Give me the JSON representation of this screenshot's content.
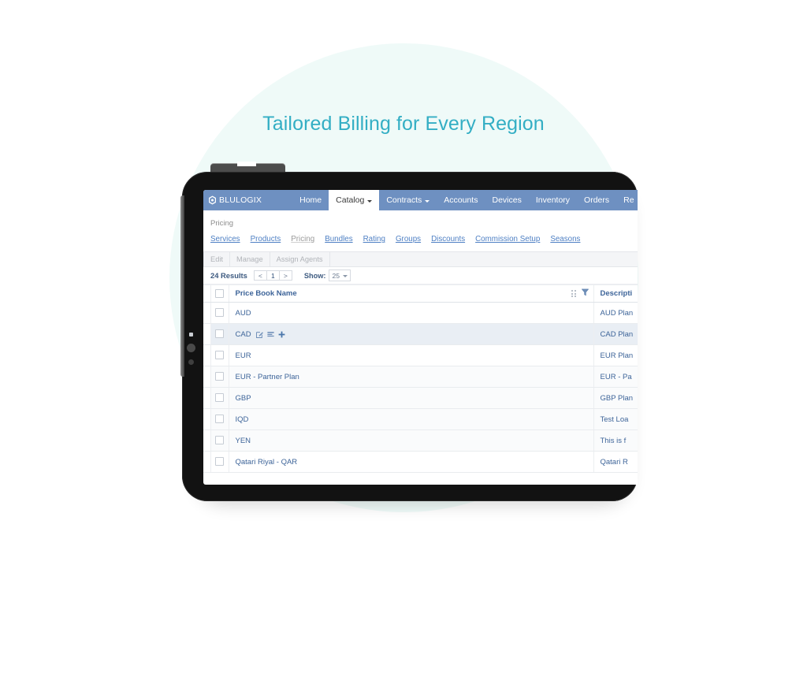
{
  "hero": {
    "title": "Tailored Billing for Every Region",
    "title_color": "#33aec4",
    "blob_color": "#effaf8"
  },
  "app": {
    "brand": "BLULOGIX",
    "brand_icon": "hexagon-logo-icon",
    "nav_bar_color": "#6e90c1",
    "nav": [
      {
        "label": "Home",
        "active": false,
        "has_caret": false
      },
      {
        "label": "Catalog",
        "active": true,
        "has_caret": true
      },
      {
        "label": "Contracts",
        "active": false,
        "has_caret": true
      },
      {
        "label": "Accounts",
        "active": false,
        "has_caret": false
      },
      {
        "label": "Devices",
        "active": false,
        "has_caret": false
      },
      {
        "label": "Inventory",
        "active": false,
        "has_caret": false
      },
      {
        "label": "Orders",
        "active": false,
        "has_caret": false
      },
      {
        "label": "Re",
        "active": false,
        "has_caret": false
      }
    ],
    "breadcrumb": "Pricing",
    "subtabs": [
      {
        "label": "Services",
        "current": false
      },
      {
        "label": "Products",
        "current": false
      },
      {
        "label": "Pricing",
        "current": true
      },
      {
        "label": "Bundles",
        "current": false
      },
      {
        "label": "Rating",
        "current": false
      },
      {
        "label": "Groups",
        "current": false
      },
      {
        "label": "Discounts",
        "current": false
      },
      {
        "label": "Commission Setup",
        "current": false
      },
      {
        "label": "Seasons",
        "current": false
      }
    ],
    "toolbar": [
      {
        "label": "Edit"
      },
      {
        "label": "Manage"
      },
      {
        "label": "Assign Agents"
      }
    ],
    "pager": {
      "results": "24 Results",
      "prev": "<",
      "page": "1",
      "next": ">",
      "show_label": "Show:",
      "show_value": "25"
    },
    "grid": {
      "columns": [
        {
          "label": "Price Book Name"
        },
        {
          "label": "Descripti"
        }
      ],
      "header_icons": [
        {
          "name": "drag-handle-icon"
        },
        {
          "name": "filter-funnel-icon"
        }
      ],
      "row_action_icons": [
        {
          "name": "edit-pencil-icon"
        },
        {
          "name": "list-lines-icon"
        },
        {
          "name": "plus-icon"
        }
      ],
      "rows": [
        {
          "name": "AUD",
          "description": "AUD Plan",
          "hover": false
        },
        {
          "name": "CAD",
          "description": "CAD Plan",
          "hover": true
        },
        {
          "name": "EUR",
          "description": "EUR Plan",
          "hover": false
        },
        {
          "name": "EUR - Partner Plan",
          "description": "EUR - Pa",
          "hover": false
        },
        {
          "name": "GBP",
          "description": "GBP Plan",
          "hover": false
        },
        {
          "name": "IQD",
          "description": "Test Loa",
          "hover": false
        },
        {
          "name": "YEN",
          "description": "This is f",
          "hover": false
        },
        {
          "name": "Qatari Riyal - QAR",
          "description": "Qatari R",
          "hover": false
        }
      ]
    }
  }
}
